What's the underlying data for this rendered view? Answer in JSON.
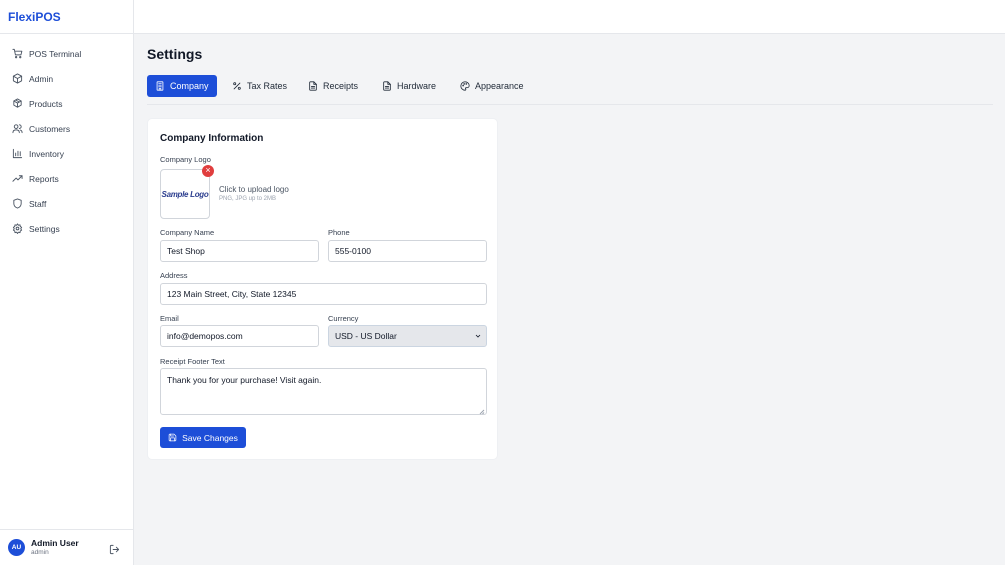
{
  "brand": "FlexiPOS",
  "sidebar": {
    "items": [
      {
        "label": "POS Terminal",
        "icon": "cart-icon"
      },
      {
        "label": "Admin",
        "icon": "package-icon"
      },
      {
        "label": "Products",
        "icon": "boxes-icon"
      },
      {
        "label": "Customers",
        "icon": "users-icon"
      },
      {
        "label": "Inventory",
        "icon": "bar-chart-icon"
      },
      {
        "label": "Reports",
        "icon": "trending-up-icon"
      },
      {
        "label": "Staff",
        "icon": "shield-icon"
      },
      {
        "label": "Settings",
        "icon": "gear-icon"
      }
    ]
  },
  "user": {
    "initials": "AU",
    "name": "Admin User",
    "role": "admin"
  },
  "page": {
    "title": "Settings"
  },
  "tabs": [
    {
      "label": "Company",
      "icon": "building-icon",
      "active": true
    },
    {
      "label": "Tax Rates",
      "icon": "percent-icon",
      "active": false
    },
    {
      "label": "Receipts",
      "icon": "document-icon",
      "active": false
    },
    {
      "label": "Hardware",
      "icon": "document-icon",
      "active": false
    },
    {
      "label": "Appearance",
      "icon": "palette-icon",
      "active": false
    }
  ],
  "company": {
    "section_title": "Company Information",
    "logo": {
      "label": "Company Logo",
      "image_text": "Sample Logo",
      "remove_symbol": "×",
      "upload_label": "Click to upload logo",
      "upload_hint": "PNG, JPG up to 2MB"
    },
    "name": {
      "label": "Company Name",
      "value": "Test Shop"
    },
    "phone": {
      "label": "Phone",
      "value": "555-0100"
    },
    "address": {
      "label": "Address",
      "value": "123 Main Street, City, State 12345"
    },
    "email": {
      "label": "Email",
      "value": "info@demopos.com"
    },
    "currency": {
      "label": "Currency",
      "value": "USD - US Dollar"
    },
    "footer": {
      "label": "Receipt Footer Text",
      "value": "Thank you for your purchase! Visit again."
    },
    "save_label": "Save Changes"
  },
  "colors": {
    "accent": "#1d4ed8",
    "danger": "#e03e3e",
    "background": "#f3f4f6"
  }
}
